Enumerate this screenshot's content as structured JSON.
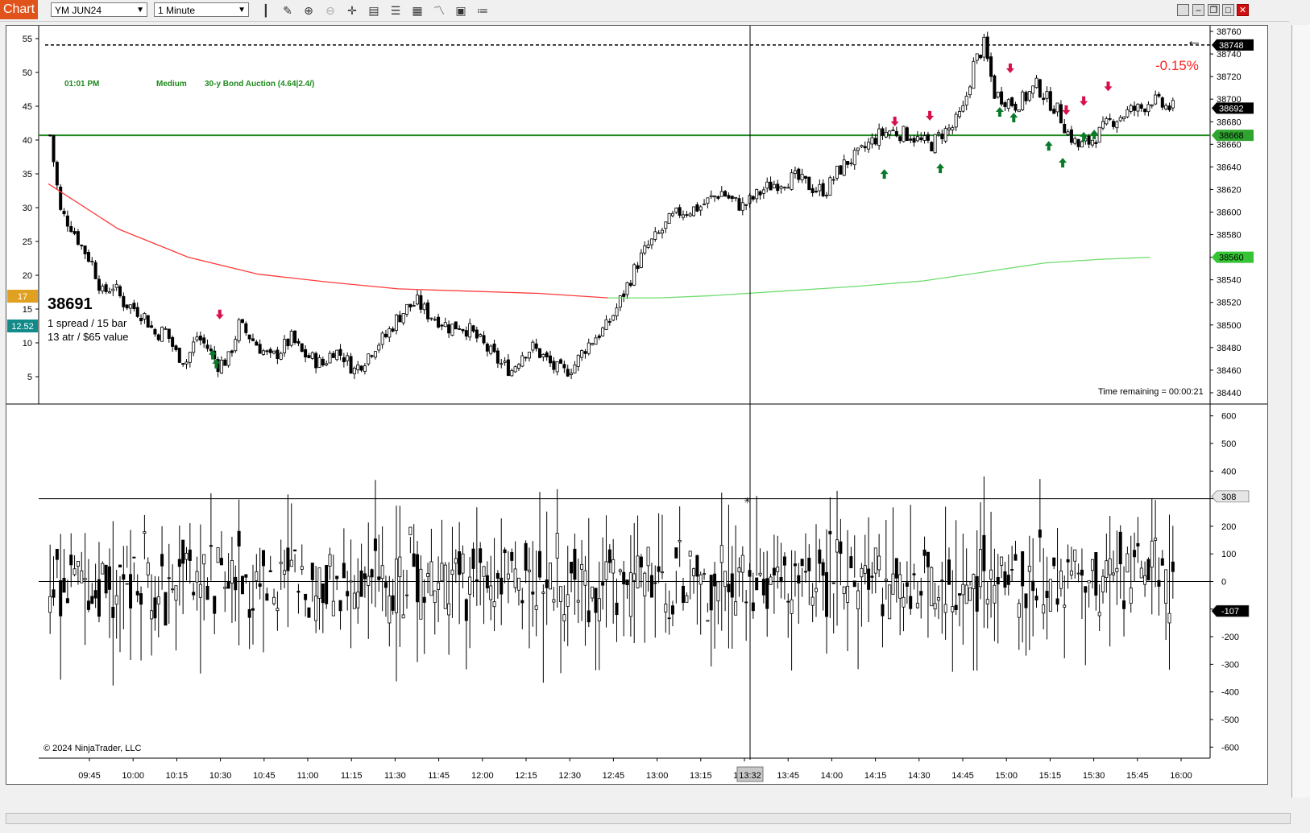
{
  "toolbar": {
    "tab_label": "Chart",
    "instrument": "YM JUN24",
    "interval": "1 Minute",
    "icons": [
      "bar-style-icon",
      "pencil-icon",
      "zoom-in-icon",
      "zoom-out-icon",
      "crosshair-icon",
      "properties-icon",
      "data-box-icon",
      "layout-icon",
      "indicators-icon",
      "strategy-icon",
      "list-icon"
    ],
    "window_buttons": [
      "min-icon",
      "restore-icon",
      "maximize-icon",
      "close-icon"
    ]
  },
  "colors": {
    "accent": "#e0541c",
    "green_level": "#1e8a1e",
    "vwap_red": "#ff3b3b",
    "vwap_green": "#6fdc6f",
    "up_arrow": "#0a7a2a",
    "down_arrow": "#d8104a",
    "pct_red": "#ff2020"
  },
  "event": {
    "time": "01:01 PM",
    "impact": "Medium",
    "name": "30-y Bond Auction (4.64|2.4/)"
  },
  "stats": {
    "price": "38691",
    "spread": "1 spread / 15 bar",
    "atr": "13 atr / $65 value"
  },
  "left_badges": [
    "17",
    "12.52"
  ],
  "pct_change": "-0.15%",
  "time_remaining": "Time remaining = 00:00:21",
  "copyright": "© 2024 NinjaTrader, LLC",
  "cursor_time": "13:32",
  "chart_data": [
    {
      "type": "candlestick",
      "left_axis_ticks": [
        "55",
        "50",
        "45",
        "40",
        "35",
        "30",
        "25",
        "20",
        "15",
        "10",
        "5"
      ],
      "right_axis_ticks": [
        "38760",
        "38740",
        "38720",
        "38700",
        "38680",
        "38660",
        "38640",
        "38620",
        "38600",
        "38580",
        "38560",
        "38540",
        "38520",
        "38500",
        "38480",
        "38460",
        "38440"
      ],
      "price_labels": [
        "38748",
        "38692",
        "38668",
        "38560"
      ],
      "x_ticks": [
        "09:45",
        "10:00",
        "10:15",
        "10:30",
        "10:45",
        "11:00",
        "11:15",
        "11:30",
        "11:45",
        "12:00",
        "12:15",
        "12:30",
        "12:45",
        "13:00",
        "13:15",
        "13:30",
        "13:45",
        "14:00",
        "14:15",
        "14:30",
        "14:45",
        "15:00",
        "15:15",
        "15:30",
        "15:45",
        "16:00"
      ],
      "ylim": [
        38430,
        38765
      ],
      "horizontal_lines": {
        "dashed_high": 38748,
        "green_level": 38668
      },
      "close_path": [
        [
          0,
          38668
        ],
        [
          3,
          38600
        ],
        [
          6,
          38588
        ],
        [
          9,
          38570
        ],
        [
          12,
          38555
        ],
        [
          15,
          38528
        ],
        [
          18,
          38535
        ],
        [
          21,
          38520
        ],
        [
          24,
          38515
        ],
        [
          27,
          38508
        ],
        [
          30,
          38492
        ],
        [
          33,
          38495
        ],
        [
          36,
          38475
        ],
        [
          39,
          38468
        ],
        [
          42,
          38490
        ],
        [
          45,
          38480
        ],
        [
          48,
          38465
        ],
        [
          51,
          38470
        ],
        [
          54,
          38500
        ],
        [
          57,
          38490
        ],
        [
          60,
          38480
        ],
        [
          63,
          38470
        ],
        [
          66,
          38478
        ],
        [
          69,
          38488
        ],
        [
          72,
          38475
        ],
        [
          75,
          38470
        ],
        [
          78,
          38465
        ],
        [
          81,
          38478
        ],
        [
          84,
          38472
        ],
        [
          87,
          38460
        ],
        [
          90,
          38470
        ],
        [
          93,
          38482
        ],
        [
          96,
          38490
        ],
        [
          99,
          38505
        ],
        [
          102,
          38515
        ],
        [
          105,
          38520
        ],
        [
          108,
          38510
        ],
        [
          111,
          38505
        ],
        [
          114,
          38498
        ],
        [
          117,
          38500
        ],
        [
          120,
          38495
        ],
        [
          123,
          38485
        ],
        [
          126,
          38475
        ],
        [
          129,
          38465
        ],
        [
          132,
          38460
        ],
        [
          135,
          38475
        ],
        [
          138,
          38480
        ],
        [
          141,
          38472
        ],
        [
          144,
          38462
        ],
        [
          147,
          38458
        ],
        [
          150,
          38465
        ],
        [
          153,
          38480
        ],
        [
          156,
          38490
        ],
        [
          159,
          38498
        ],
        [
          162,
          38515
        ],
        [
          165,
          38535
        ],
        [
          168,
          38555
        ],
        [
          171,
          38570
        ],
        [
          174,
          38580
        ],
        [
          177,
          38592
        ],
        [
          180,
          38600
        ],
        [
          183,
          38602
        ],
        [
          186,
          38605
        ],
        [
          189,
          38612
        ],
        [
          192,
          38618
        ],
        [
          195,
          38610
        ],
        [
          198,
          38605
        ],
        [
          201,
          38612
        ],
        [
          204,
          38620
        ],
        [
          207,
          38625
        ],
        [
          210,
          38628
        ],
        [
          213,
          38630
        ],
        [
          216,
          38625
        ],
        [
          219,
          38620
        ],
        [
          222,
          38620
        ],
        [
          225,
          38635
        ],
        [
          228,
          38645
        ],
        [
          231,
          38650
        ],
        [
          234,
          38660
        ],
        [
          237,
          38668
        ],
        [
          240,
          38672
        ],
        [
          243,
          38670
        ],
        [
          246,
          38668
        ],
        [
          249,
          38662
        ],
        [
          252,
          38660
        ],
        [
          255,
          38670
        ],
        [
          258,
          38675
        ],
        [
          261,
          38690
        ],
        [
          264,
          38730
        ],
        [
          267,
          38748
        ],
        [
          270,
          38705
        ],
        [
          273,
          38700
        ],
        [
          276,
          38695
        ],
        [
          279,
          38702
        ],
        [
          282,
          38712
        ],
        [
          285,
          38700
        ],
        [
          288,
          38690
        ],
        [
          291,
          38670
        ],
        [
          294,
          38658
        ],
        [
          297,
          38662
        ],
        [
          300,
          38670
        ],
        [
          303,
          38680
        ],
        [
          306,
          38685
        ],
        [
          309,
          38690
        ],
        [
          312,
          38692
        ],
        [
          315,
          38700
        ],
        [
          318,
          38694
        ],
        [
          321,
          38692
        ]
      ],
      "vwap_points": [
        [
          0,
          38625
        ],
        [
          20,
          38585
        ],
        [
          40,
          38560
        ],
        [
          60,
          38545
        ],
        [
          80,
          38538
        ],
        [
          100,
          38532
        ],
        [
          120,
          38530
        ],
        [
          140,
          38528
        ],
        [
          160,
          38524
        ],
        [
          175,
          38524
        ],
        [
          190,
          38526
        ],
        [
          210,
          38530
        ],
        [
          230,
          38534
        ],
        [
          250,
          38539
        ],
        [
          270,
          38548
        ],
        [
          285,
          38555
        ],
        [
          300,
          38558
        ],
        [
          315,
          38560
        ]
      ],
      "vwap_red_until": 163,
      "up_arrows": [
        [
          47,
          38478
        ],
        [
          48,
          38470
        ],
        [
          239,
          38638
        ],
        [
          255,
          38643
        ],
        [
          272,
          38693
        ],
        [
          276,
          38688
        ],
        [
          286,
          38663
        ],
        [
          290,
          38648
        ],
        [
          296,
          38671
        ],
        [
          299,
          38673
        ]
      ],
      "down_arrows": [
        [
          49,
          38505
        ],
        [
          242,
          38676
        ],
        [
          252,
          38681
        ],
        [
          275,
          38723
        ],
        [
          291,
          38686
        ],
        [
          296,
          38694
        ],
        [
          303,
          38707
        ]
      ]
    },
    {
      "type": "bar-oscillator",
      "right_axis_ticks": [
        "600",
        "500",
        "400",
        "300",
        "200",
        "100",
        "0",
        "-100",
        "-200",
        "-300",
        "-400",
        "-500",
        "-600"
      ],
      "value_labels": [
        "308",
        "-107"
      ],
      "ylim": [
        -640,
        640
      ],
      "horizontal_lines": [
        300,
        0
      ],
      "last_value": -107
    }
  ]
}
